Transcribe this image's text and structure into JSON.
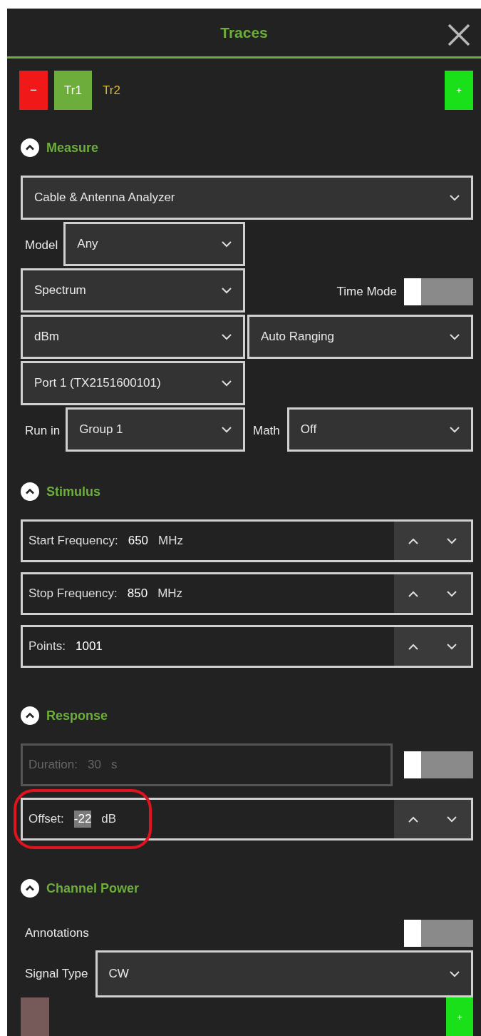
{
  "panel": {
    "title": "Traces"
  },
  "trace_bar": {
    "remove_label": "−",
    "add_label": "+",
    "traces": [
      {
        "label": "Tr1",
        "selected": true
      },
      {
        "label": "Tr2",
        "selected": false
      }
    ]
  },
  "sections": [
    {
      "title": "Measure",
      "expanded": true,
      "rows": [
        {
          "kind": "wide-select",
          "value": "Cable & Antenna Analyzer"
        },
        {
          "kind": "pair",
          "left": [
            {
              "kind": "label",
              "text": "Model"
            },
            {
              "kind": "select",
              "value": "Any"
            }
          ],
          "right": []
        },
        {
          "kind": "pair",
          "left": [
            {
              "kind": "select",
              "value": "Spectrum"
            }
          ],
          "right": [
            {
              "kind": "label",
              "text": "Time Mode"
            },
            {
              "kind": "toggle",
              "on": false
            }
          ]
        },
        {
          "kind": "pair",
          "left": [
            {
              "kind": "select",
              "value": "dBm"
            }
          ],
          "right": [
            {
              "kind": "select",
              "value": "Auto Ranging"
            }
          ]
        },
        {
          "kind": "pair",
          "left": [
            {
              "kind": "select",
              "value": "Port 1 (TX2151600101)"
            }
          ],
          "right": []
        },
        {
          "kind": "pair",
          "left": [
            {
              "kind": "label",
              "text": "Run in"
            },
            {
              "kind": "select",
              "value": "Group 1"
            }
          ],
          "right": [
            {
              "kind": "label",
              "text": "Math"
            },
            {
              "kind": "select",
              "value": "Off"
            }
          ]
        }
      ]
    },
    {
      "title": "Stimulus",
      "expanded": true,
      "rows": [
        {
          "kind": "spinner",
          "label": "Start Frequency:",
          "value": "650",
          "unit": "MHz",
          "value_selected": false,
          "highlighted": false
        },
        {
          "kind": "spinner",
          "label": "Stop Frequency:",
          "value": "850",
          "unit": "MHz",
          "value_selected": false,
          "highlighted": false
        },
        {
          "kind": "spinner",
          "label": "Points:",
          "value": "1001",
          "value_selected": false,
          "highlighted": false
        }
      ]
    },
    {
      "title": "Response",
      "expanded": true,
      "rows": [
        {
          "kind": "field-toggle",
          "label": "Duration:",
          "value": "30",
          "unit": "s",
          "disabled": true,
          "on": false
        },
        {
          "kind": "spinner",
          "label": "Offset:",
          "value": "-22",
          "unit": "dB",
          "value_selected": true,
          "highlighted": true
        }
      ]
    },
    {
      "title": "Channel Power",
      "expanded": true,
      "rows": [
        {
          "kind": "label-toggle",
          "label": "Annotations",
          "on": false
        },
        {
          "kind": "label-select",
          "label": "Signal Type",
          "value": "CW"
        }
      ]
    }
  ],
  "footer": {
    "add_label": "+"
  }
}
